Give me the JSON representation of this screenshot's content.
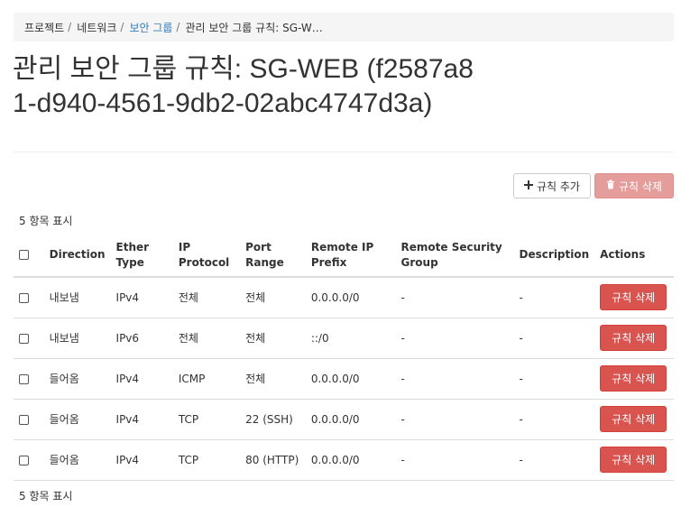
{
  "breadcrumb": {
    "items": [
      {
        "label": "프로젝트",
        "link": false
      },
      {
        "label": "네트워크",
        "link": false
      },
      {
        "label": "보안 그룹",
        "link": true
      },
      {
        "label": "관리 보안 그룹 규칙: SG-W…",
        "link": false
      }
    ],
    "separator": "/"
  },
  "page": {
    "title": "관리 보안 그룹 규칙: SG-WEB (f2587a81-d940-4561-9db2-02abc4747d3a)"
  },
  "actions": {
    "add_rule_label": "규칙 추가",
    "delete_rules_label": "규칙 삭제",
    "delete_rules_disabled": true
  },
  "table": {
    "count_label_top": "5 항목 표시",
    "count_label_bottom": "5 항목 표시",
    "headers": {
      "direction": "Direction",
      "ether_type_1": "Ether",
      "ether_type_2": "Type",
      "ip_protocol_1": "IP",
      "ip_protocol_2": "Protocol",
      "port_range_1": "Port",
      "port_range_2": "Range",
      "remote_ip_1": "Remote IP",
      "remote_ip_2": "Prefix",
      "remote_sg_1": "Remote Security",
      "remote_sg_2": "Group",
      "description": "Description",
      "actions": "Actions"
    },
    "rows": [
      {
        "direction": "내보냄",
        "ether_type": "IPv4",
        "protocol": "전체",
        "port_range": "전체",
        "remote_ip": "0.0.0.0/0",
        "remote_sg": "-",
        "description": "-",
        "action": "규칙 삭제"
      },
      {
        "direction": "내보냄",
        "ether_type": "IPv6",
        "protocol": "전체",
        "port_range": "전체",
        "remote_ip": "::/0",
        "remote_sg": "-",
        "description": "-",
        "action": "규칙 삭제"
      },
      {
        "direction": "들어옴",
        "ether_type": "IPv4",
        "protocol": "ICMP",
        "port_range": "전체",
        "remote_ip": "0.0.0.0/0",
        "remote_sg": "-",
        "description": "-",
        "action": "규칙 삭제"
      },
      {
        "direction": "들어옴",
        "ether_type": "IPv4",
        "protocol": "TCP",
        "port_range": "22 (SSH)",
        "remote_ip": "0.0.0.0/0",
        "remote_sg": "-",
        "description": "-",
        "action": "규칙 삭제"
      },
      {
        "direction": "들어옴",
        "ether_type": "IPv4",
        "protocol": "TCP",
        "port_range": "80 (HTTP)",
        "remote_ip": "0.0.0.0/0",
        "remote_sg": "-",
        "description": "-",
        "action": "규칙 삭제"
      }
    ]
  },
  "icons": {
    "add": "plus-icon",
    "delete": "trash-icon"
  },
  "colors": {
    "link": "#337ab7",
    "danger": "#d9534f",
    "danger_disabled": "#e59d9b"
  }
}
